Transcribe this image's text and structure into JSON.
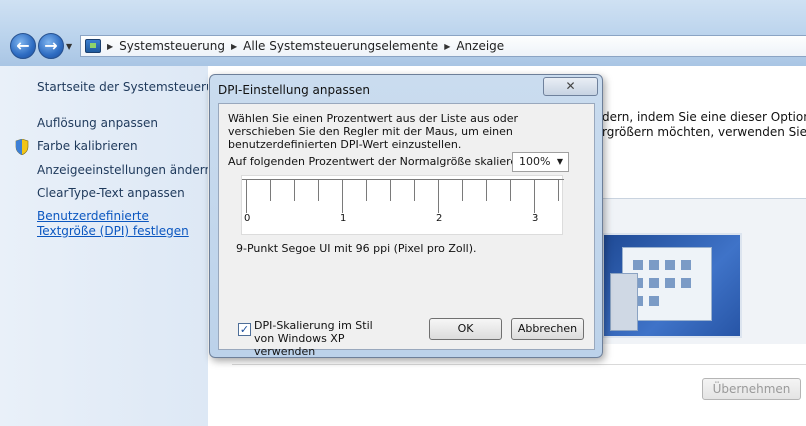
{
  "navigation": {
    "back_icon": "back-arrow-icon",
    "forward_icon": "forward-arrow-icon",
    "breadcrumbs": [
      "Systemsteuerung",
      "Alle Systemsteuerungselemente",
      "Anzeige"
    ]
  },
  "sidebar": {
    "home_link": "Startseite der Systemsteuerung",
    "items": [
      {
        "label": "Auflösung anpassen"
      },
      {
        "label": "Farbe kalibrieren",
        "icon": "shield-icon"
      },
      {
        "label": "Anzeigeeinstellungen ändern"
      },
      {
        "label": "ClearType-Text anpassen"
      },
      {
        "label": "Benutzerdefinierte Textgröße (DPI) festlegen"
      }
    ]
  },
  "main": {
    "text_line1": "dern, indem Sie eine dieser Optionen",
    "text_line2": "rgrößern möchten, verwenden Sie die",
    "apply_button": "Übernehmen"
  },
  "dialog": {
    "title": "DPI-Einstellung anpassen",
    "description": "Wählen Sie einen Prozentwert aus der Liste aus oder verschieben Sie den Regler mit der Maus, um einen benutzerdefinierten DPI-Wert einzustellen.",
    "scale_label": "Auf folgenden Prozentwert der Normalgröße skalieren:",
    "scale_value": "100%",
    "ruler_numbers": [
      "0",
      "1",
      "2",
      "3"
    ],
    "font_info": "9-Punkt Segoe UI mit 96 ppi (Pixel pro Zoll).",
    "xp_checkbox_label": "DPI-Skalierung im Stil von Windows XP verwenden",
    "xp_checkbox_checked": true,
    "ok_button": "OK",
    "cancel_button": "Abbrechen"
  }
}
